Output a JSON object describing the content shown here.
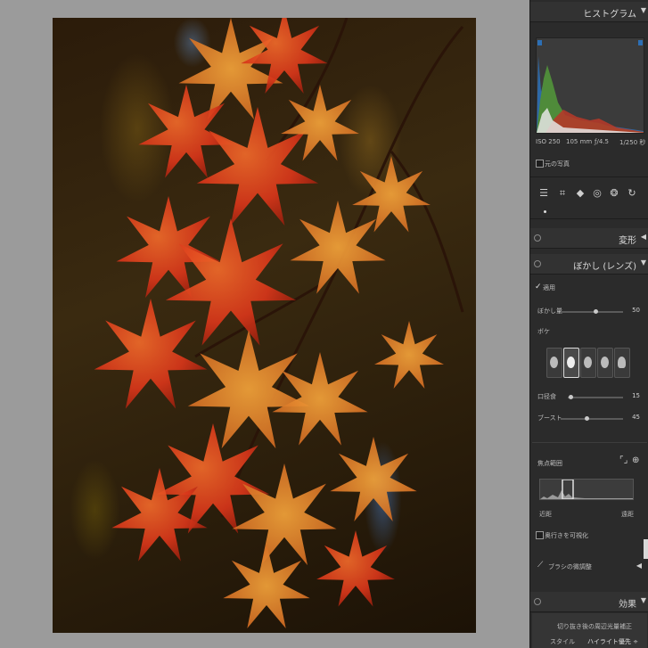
{
  "histogram": {
    "title": "ヒストグラム",
    "shutter": "ISO 250",
    "focal": "105 mm",
    "aperture": "ƒ/4.5",
    "exposure": "1/250 秒",
    "original_photo_label": "元の写真"
  },
  "sections": {
    "transform_title": "変形",
    "lens_blur_title": "ぼかし (レンズ)",
    "effects_title": "効果"
  },
  "lens_blur": {
    "apply_label": "適用",
    "amount_label": "ぼかし量",
    "amount_value": "50",
    "bokeh_label": "ボケ",
    "bokeh_amount_label": "口径食",
    "bokeh_amount_value": "15",
    "boost_label": "ブースト",
    "boost_value": "45",
    "amount_fraction": 0.55,
    "bokeh_amount_fraction": 0.05,
    "boost_fraction": 0.42,
    "focal_range_label": "焦点範囲",
    "near_label": "近距",
    "far_label": "遠距",
    "visualize_depth_label": "奥行きを可視化",
    "brush_label": "ブラシの微調整"
  },
  "effects": {
    "line1": "切り抜き後の周辺光量補正",
    "style_label": "スタイル",
    "style_value": "ハイライト優先 ÷"
  },
  "colors": {
    "panel_bg": "#2b2b2b",
    "canvas_bg": "#9b9b9b",
    "hist_green": "#4f8b3a",
    "hist_red": "#b33a2a",
    "hist_blue": "#2c6fb5"
  }
}
